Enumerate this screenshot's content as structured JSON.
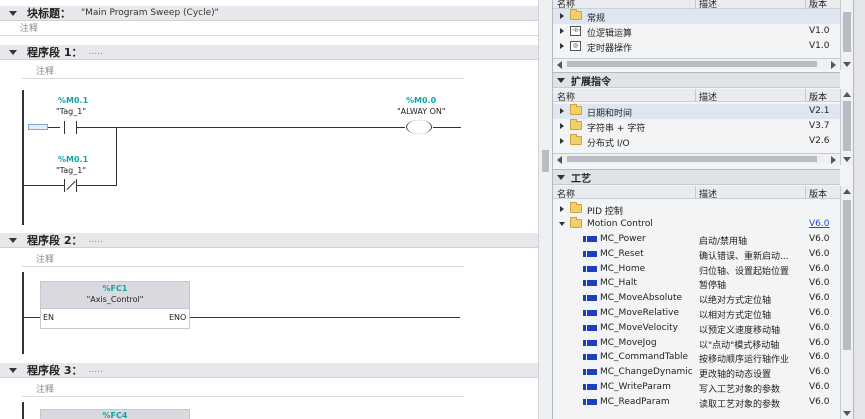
{
  "editor": {
    "block_title_label": "块标题：",
    "block_title_value": "\"Main Program Sweep (Cycle)\"",
    "block_comment": "注释",
    "networks": [
      {
        "label": "程序段 1：",
        "dots": ".....",
        "comment": "注释",
        "contact1": {
          "addr": "%M0.1",
          "tag": "\"Tag_1\""
        },
        "contact2": {
          "addr": "%M0.1",
          "tag": "\"Tag_1\""
        },
        "coil": {
          "addr": "%M0.0",
          "tag": "\"ALWAY ON\""
        }
      },
      {
        "label": "程序段 2：",
        "dots": ".....",
        "comment": "注释",
        "fc": {
          "addr": "%FC1",
          "name": "\"Axis_Control\"",
          "en": "EN",
          "eno": "ENO"
        }
      },
      {
        "label": "程序段 3：",
        "dots": ".....",
        "comment": "注释",
        "fc": {
          "addr": "%FC4"
        }
      }
    ]
  },
  "basic_pane": {
    "col_name": "名称",
    "col_desc": "描述",
    "col_ver": "版本",
    "items": [
      {
        "name": "常规",
        "version": ""
      },
      {
        "name": "位逻辑运算",
        "version": "V1.0"
      },
      {
        "name": "定时器操作",
        "version": "V1.0"
      }
    ]
  },
  "extended_pane": {
    "title": "扩展指令",
    "col_name": "名称",
    "col_desc": "描述",
    "col_ver": "版本",
    "items": [
      {
        "name": "日期和时间",
        "version": "V2.1"
      },
      {
        "name": "字符串 + 字符",
        "version": "V3.7"
      },
      {
        "name": "分布式 I/O",
        "version": "V2.6"
      }
    ]
  },
  "tech_pane": {
    "title": "工艺",
    "col_name": "名称",
    "col_desc": "描述",
    "col_ver": "版本",
    "folders": [
      {
        "name": "PID 控制",
        "version": ""
      },
      {
        "name": "Motion Control",
        "version": "V6.0"
      }
    ],
    "instructions": [
      {
        "name": "MC_Power",
        "desc": "启动/禁用轴",
        "version": "V6.0"
      },
      {
        "name": "MC_Reset",
        "desc": "确认错误、重新启动...",
        "version": "V6.0"
      },
      {
        "name": "MC_Home",
        "desc": "归位轴、设置起始位置",
        "version": "V6.0"
      },
      {
        "name": "MC_Halt",
        "desc": "暂停轴",
        "version": "V6.0"
      },
      {
        "name": "MC_MoveAbsolute",
        "desc": "以绝对方式定位轴",
        "version": "V6.0"
      },
      {
        "name": "MC_MoveRelative",
        "desc": "以相对方式定位轴",
        "version": "V6.0"
      },
      {
        "name": "MC_MoveVelocity",
        "desc": "以预定义速度移动轴",
        "version": "V6.0"
      },
      {
        "name": "MC_MoveJog",
        "desc": "以\"点动\"模式移动轴",
        "version": "V6.0"
      },
      {
        "name": "MC_CommandTable",
        "desc": "按移动顺序运行轴作业",
        "version": "V6.0"
      },
      {
        "name": "MC_ChangeDynamic",
        "desc": "更改轴的动态设置",
        "version": "V6.0"
      },
      {
        "name": "MC_WriteParam",
        "desc": "写入工艺对象的参数",
        "version": "V6.0"
      },
      {
        "name": "MC_ReadParam",
        "desc": "读取工艺对象的参数",
        "version": "V6.0"
      }
    ]
  },
  "colors": {
    "address_teal": "#16a3a3",
    "instr_blue": "#1d3fbf",
    "link_blue": "#1f4fd1",
    "folder_yellow": "#f2cf6a"
  }
}
